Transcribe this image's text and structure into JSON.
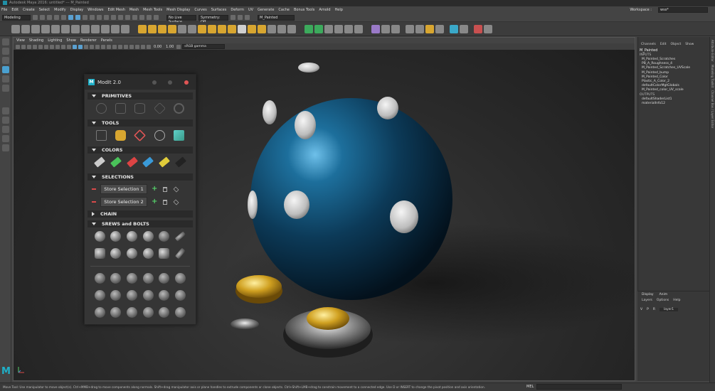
{
  "title_bar": {
    "text": "Autodesk Maya 2016: untitled* --- M_Painted"
  },
  "menu": {
    "items": [
      "File",
      "Edit",
      "Create",
      "Select",
      "Modify",
      "Display",
      "Windows",
      "Edit Mesh",
      "Mesh",
      "Mesh Tools",
      "Mesh Display",
      "Curves",
      "Surfaces",
      "Deform",
      "UV",
      "Generate",
      "Cache",
      "Bonus Tools",
      "Arnold",
      "Help"
    ],
    "workspace_label": "Workspace :",
    "workspace_value": "wss*"
  },
  "status_line": {
    "menuset": "Modeling",
    "live_surface": "No Live Surface",
    "symmetry": "Symmetry: Off",
    "selection_field": "M_Painted"
  },
  "viewport": {
    "menu": [
      "View",
      "Shading",
      "Lighting",
      "Show",
      "Renderer",
      "Panels"
    ],
    "near": "0.00",
    "far": "1.00",
    "color_space": "sRGB gamma"
  },
  "modit": {
    "title": "ModIt 2.0",
    "logo_letter": "M",
    "sections": {
      "primitives": "PRIMITIVES",
      "tools": "TOOLS",
      "colors": "COLORS",
      "selections": "SELECTIONS",
      "chain": "CHAIN",
      "screws": "SREWS and BOLTS"
    },
    "primitive_icons": [
      "sphere-icon",
      "cube-icon",
      "cylinder-icon",
      "plane-icon",
      "torus-icon"
    ],
    "tool_icons": [
      "duplicate-tool-icon",
      "bolt-tool-icon",
      "mirror-tool-icon",
      "pivot-tool-icon",
      "bevel-tool-icon"
    ],
    "colors": [
      {
        "name": "grey",
        "hex": "#cccccc"
      },
      {
        "name": "green",
        "hex": "#4ac25a"
      },
      {
        "name": "red",
        "hex": "#dd4444"
      },
      {
        "name": "blue",
        "hex": "#3a9ad8"
      },
      {
        "name": "yellow",
        "hex": "#e0cc3a"
      },
      {
        "name": "black",
        "hex": "#222222"
      }
    ],
    "selections": [
      {
        "label": "Store Selection 1"
      },
      {
        "label": "Store Selection 2"
      }
    ],
    "selection_plus": "+"
  },
  "channel_box": {
    "menu": [
      "Channels",
      "Edit",
      "Object",
      "Show"
    ],
    "object_name": "M_Painted",
    "inputs_label": "INPUTS",
    "inputs": [
      "M_Painted_Scratches",
      "PB_A_Roughness_4",
      "M_Painted_Scratches_UVScale",
      "M_Painted_bump",
      "M_Painted_Color",
      "Plastic_A_Color_2",
      "defaultColorMgtGlobals",
      "M_Painted_color_UV_scale"
    ],
    "outputs_label": "OUTPUTS",
    "outputs": [
      "defaultShaderList1",
      "materialInfo12"
    ]
  },
  "side_tabs": [
    "Attribute Editor",
    "Modeling Toolkit",
    "Channel Box / Layer Editor"
  ],
  "layer_editor": {
    "tabs": [
      "Display",
      "Anim"
    ],
    "menu": [
      "Layers",
      "Options",
      "Help"
    ],
    "layer_flags": [
      "V",
      "P",
      "R"
    ],
    "layer_name": "layer1"
  },
  "help_line": {
    "text": "Move Tool: Use manipulator to move object(s). Ctrl+MMB+drag to move components along normals. Shift+drag manipulator axis or plane handles to extrude components or clone objects. Ctrl+Shift+LMB+drag to constrain movement to a connected edge. Use D or INSERT to change the pivot position and axis orientation."
  },
  "command_line": {
    "label": "MEL"
  },
  "logo": {
    "letter": "M"
  }
}
